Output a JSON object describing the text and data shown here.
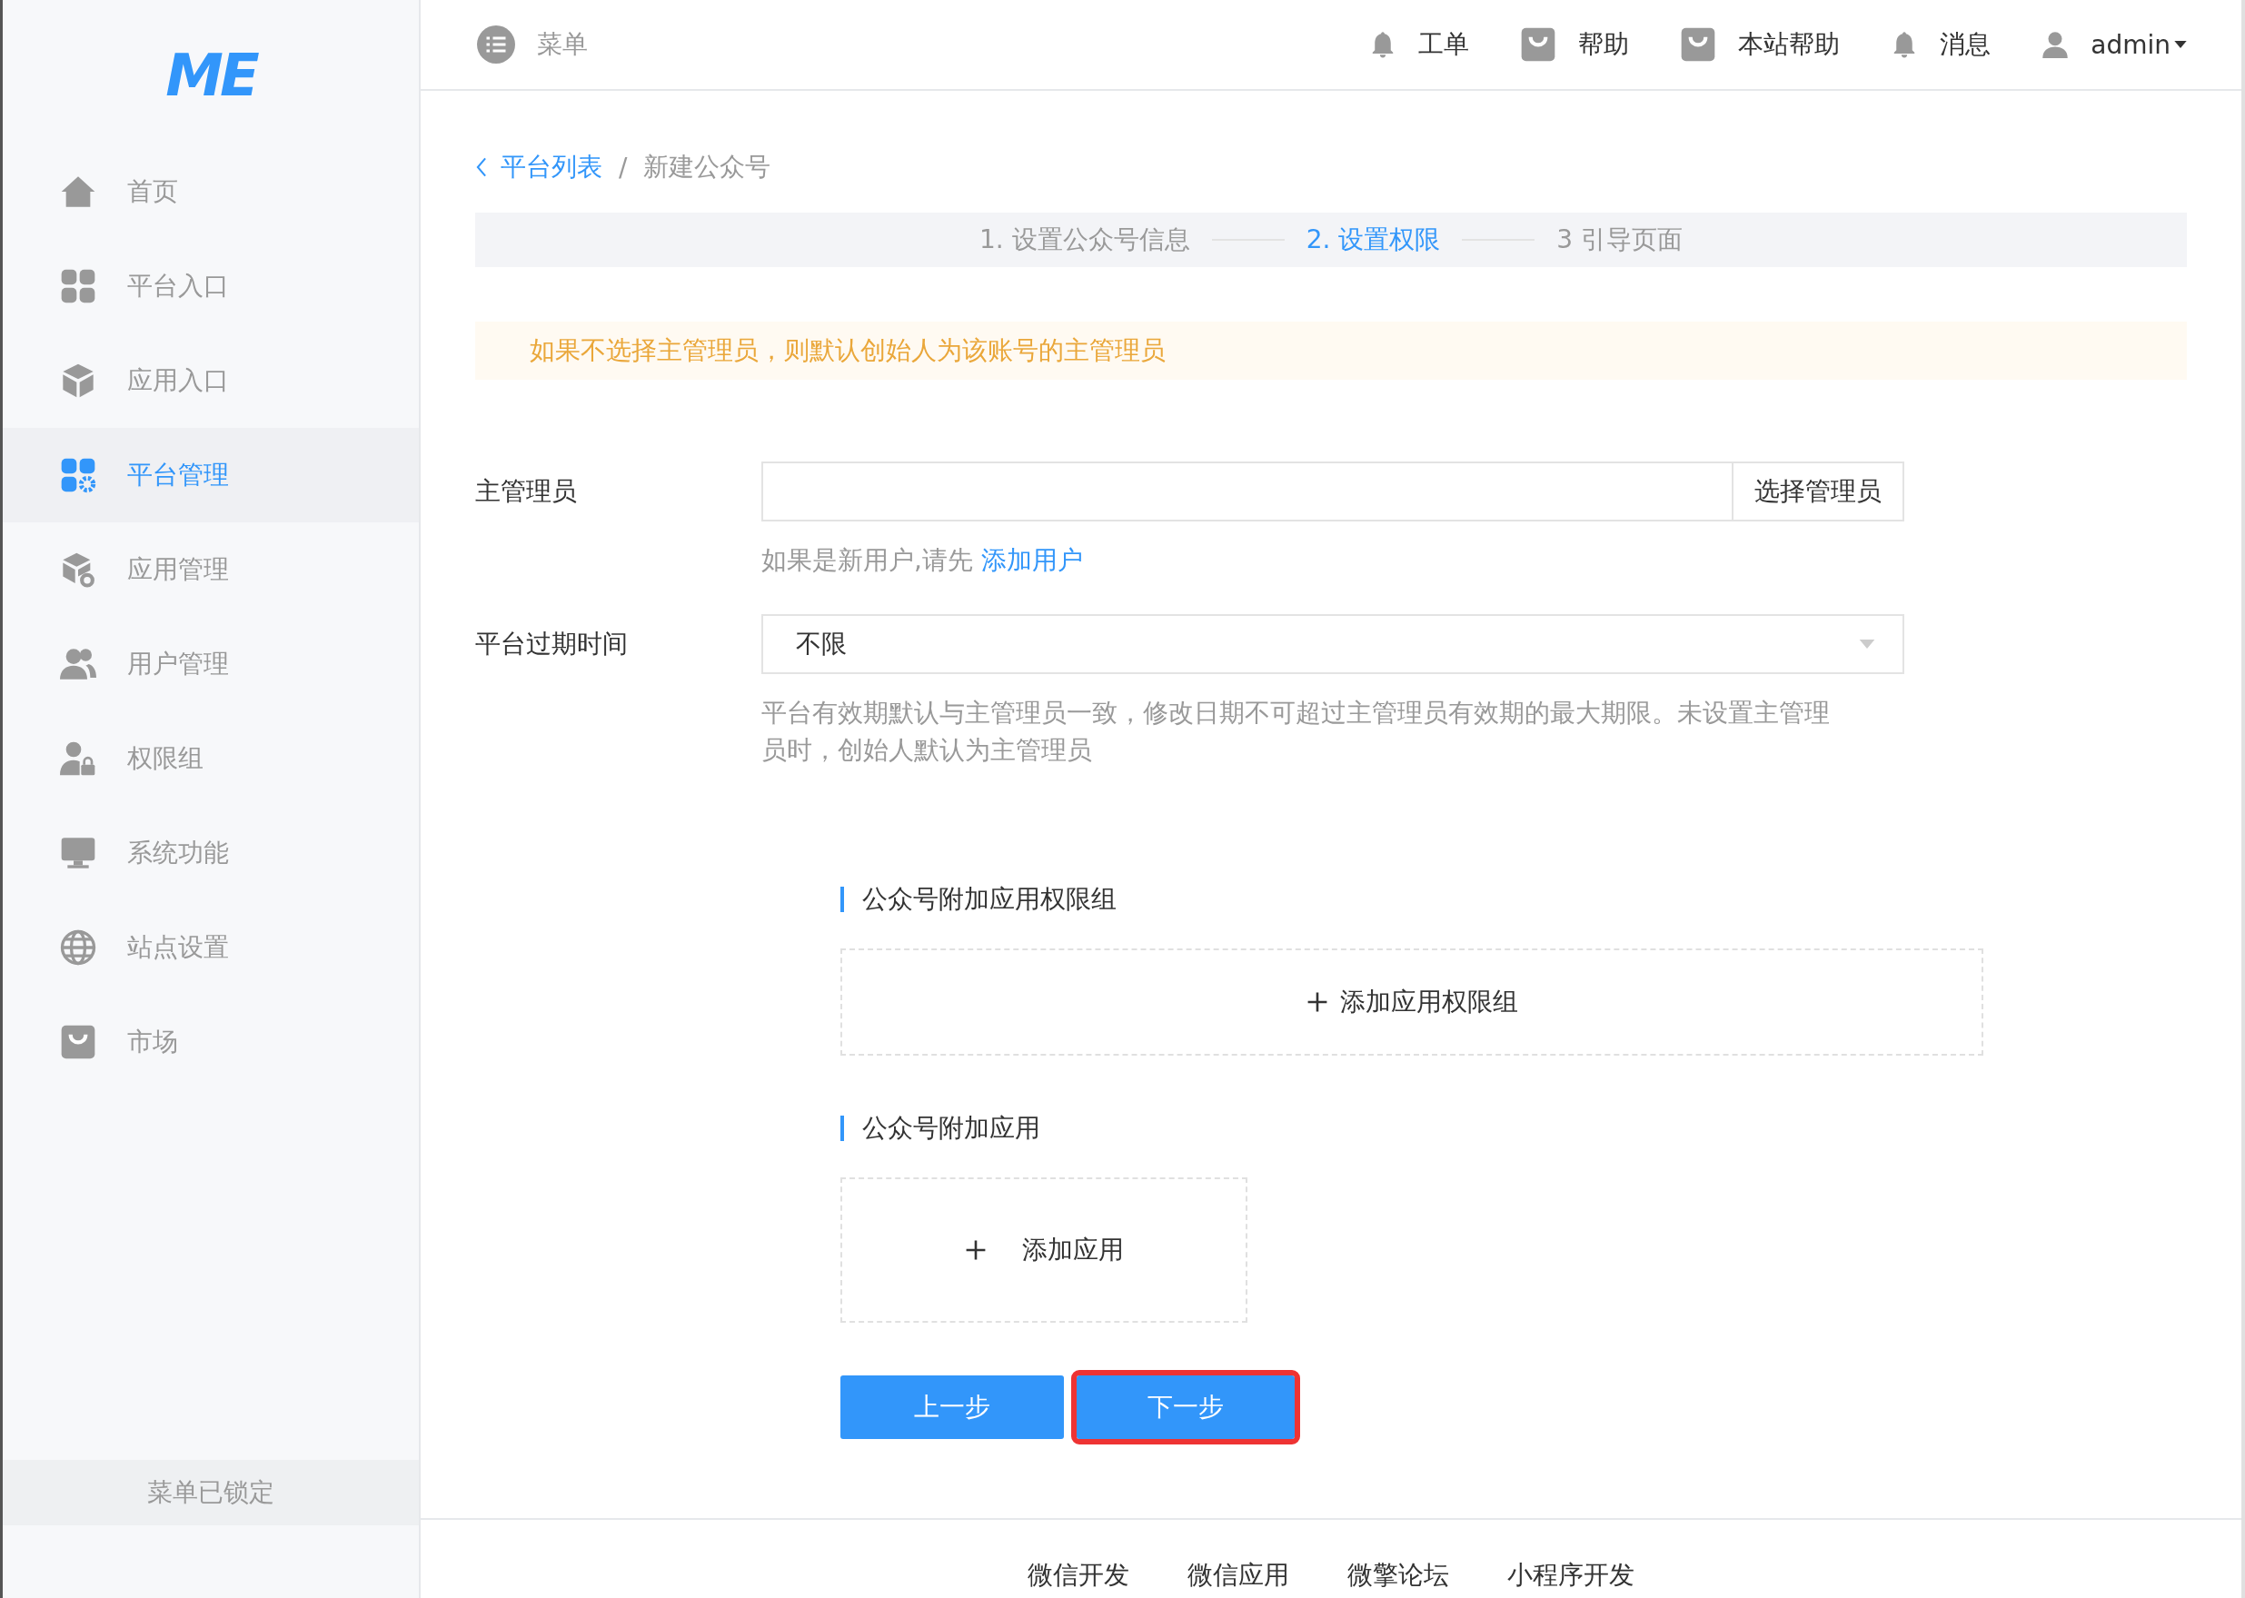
{
  "logo": "ME",
  "sidebar": {
    "items": [
      {
        "label": "首页",
        "selected": false
      },
      {
        "label": "平台入口",
        "selected": false
      },
      {
        "label": "应用入口",
        "selected": false
      },
      {
        "label": "平台管理",
        "selected": true
      },
      {
        "label": "应用管理",
        "selected": false
      },
      {
        "label": "用户管理",
        "selected": false
      },
      {
        "label": "权限组",
        "selected": false
      },
      {
        "label": "系统功能",
        "selected": false
      },
      {
        "label": "站点设置",
        "selected": false
      },
      {
        "label": "市场",
        "selected": false
      }
    ],
    "footer": "菜单已锁定"
  },
  "header": {
    "menu": "菜单",
    "items": [
      {
        "label": "工单"
      },
      {
        "label": "帮助"
      },
      {
        "label": "本站帮助"
      },
      {
        "label": "消息"
      },
      {
        "label": "admin"
      }
    ]
  },
  "breadcrumb": {
    "back": "平台列表",
    "separator": "/",
    "current": "新建公众号"
  },
  "steps": [
    {
      "label": "1. 设置公众号信息",
      "selected": false
    },
    {
      "label": "2. 设置权限",
      "selected": true
    },
    {
      "label": "3 引导页面",
      "selected": false
    }
  ],
  "alert": "如果不选择主管理员，则默认创始人为该账号的主管理员",
  "admin_field": {
    "label": "主管理员",
    "button": "选择管理员",
    "hint": "如果是新用户,请先",
    "hint_link": "添加用户"
  },
  "expiry_field": {
    "label": "平台过期时间",
    "value": "不限",
    "help": "平台有效期默认与主管理员一致，修改日期不可超过主管理员有效期的最大期限。未设置主管理员时，创始人默认为主管理员"
  },
  "sections": [
    {
      "title": "公众号附加应用权限组",
      "add": "添加应用权限组",
      "kind": "wide"
    },
    {
      "title": "公众号附加应用",
      "add": "添加应用",
      "kind": "tile"
    }
  ],
  "buttons": [
    {
      "label": "上一步",
      "highlighted": false
    },
    {
      "label": "下一步",
      "highlighted": true
    }
  ],
  "footer_links": [
    "微信开发",
    "微信应用",
    "微擎论坛",
    "小程序开发"
  ]
}
